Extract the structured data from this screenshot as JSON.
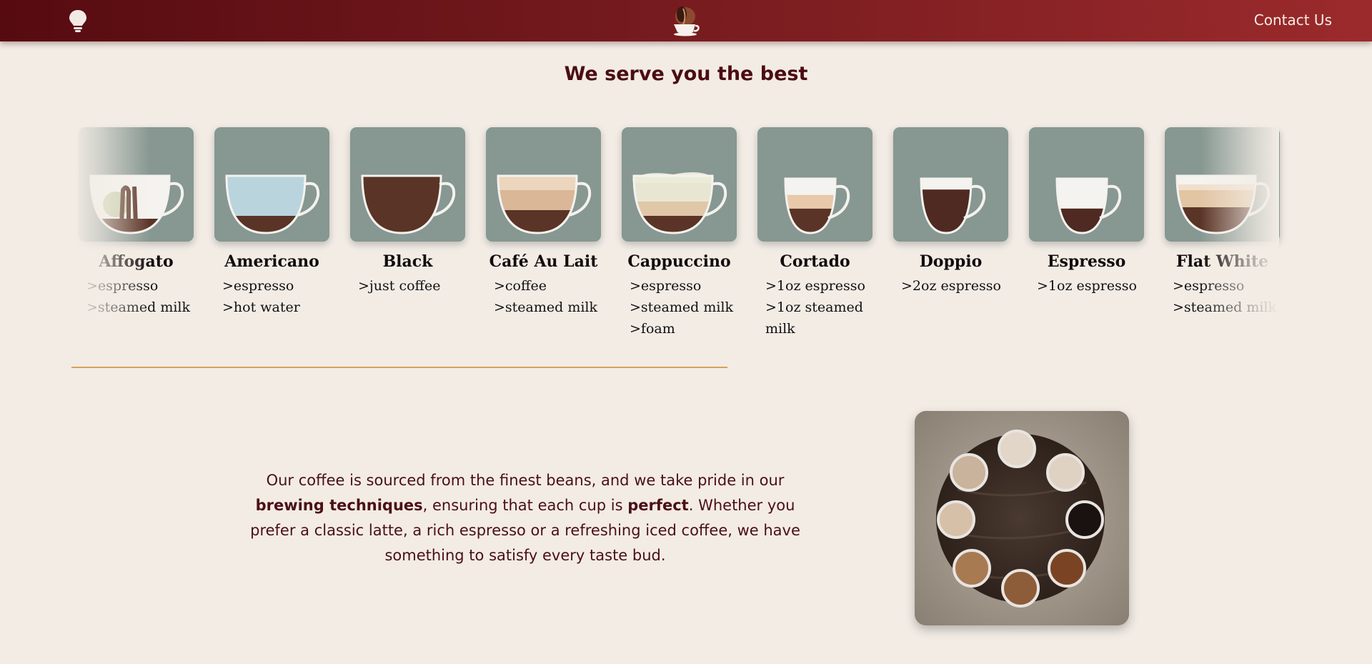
{
  "header": {
    "icon_left": "lightbulb-icon",
    "logo": "coffee-cup-logo",
    "contact_label": "Contact Us"
  },
  "section_title": "We serve you the best",
  "menu": [
    {
      "name": "Affogato",
      "desc": [
        ">espresso",
        ">steamed milk"
      ]
    },
    {
      "name": "Americano",
      "desc": [
        ">espresso",
        ">hot water"
      ]
    },
    {
      "name": "Black",
      "desc": [
        ">just coffee"
      ]
    },
    {
      "name": "Café Au Lait",
      "desc": [
        ">coffee",
        ">steamed milk"
      ]
    },
    {
      "name": "Cappuccino",
      "desc": [
        ">espresso",
        ">steamed milk",
        ">foam"
      ]
    },
    {
      "name": "Cortado",
      "desc": [
        ">1oz espresso",
        ">1oz steamed",
        "milk"
      ]
    },
    {
      "name": "Doppio",
      "desc": [
        ">2oz espresso"
      ]
    },
    {
      "name": "Espresso",
      "desc": [
        ">1oz espresso"
      ]
    },
    {
      "name": "Flat White",
      "desc": [
        ">espresso",
        ">steamed milk"
      ]
    }
  ],
  "about": {
    "part1": "Our coffee is sourced from the finest beans, and we take pride in our",
    "bold1": "brewing techniques",
    "part2": ", ensuring that each cup is ",
    "bold2": "perfect",
    "part3": ". Whether you prefer a classic latte, a rich espresso or a refreshing iced coffee, we have something to satisfy every taste bud."
  },
  "colors": {
    "background": "#f2ece5",
    "header_start": "#560b10",
    "header_end": "#9b2a2c",
    "card": "#879791",
    "accent_line": "#d9a05b",
    "text_dark_red": "#4b0d12"
  }
}
